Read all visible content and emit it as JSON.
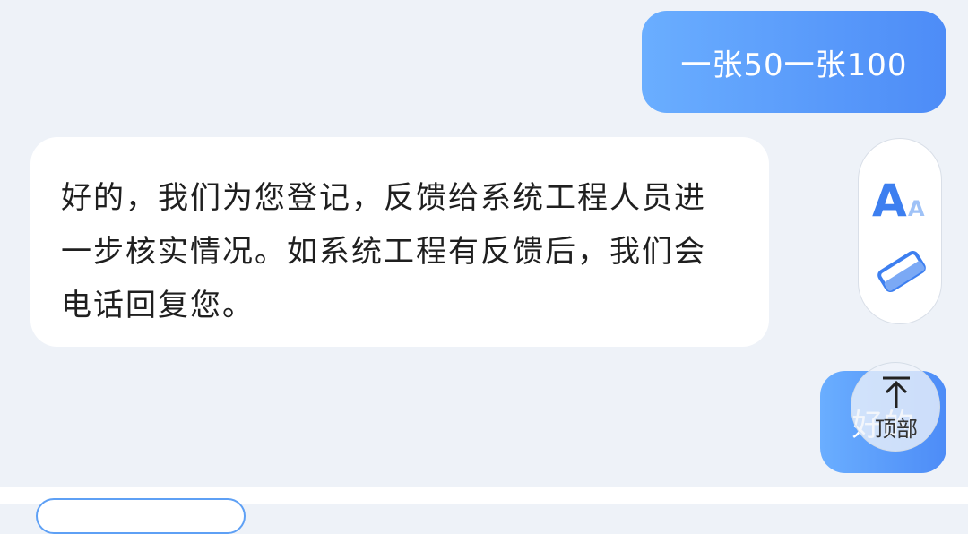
{
  "chat": {
    "messages": [
      {
        "role": "user",
        "text": "一张50一张100"
      },
      {
        "role": "bot",
        "text": "好的，我们为您登记，反馈给系统工程人员进一步核实情况。如系统工程有反馈后，我们会电话回复您。"
      },
      {
        "role": "user",
        "text": "好的"
      }
    ]
  },
  "tools": {
    "font_size_icon": "font-size-icon",
    "eraser_icon": "eraser-icon"
  },
  "scroll_top": {
    "label": "顶部",
    "icon": "arrow-up-to-top-icon"
  },
  "colors": {
    "background": "#eef2f8",
    "user_bubble_start": "#6aaeff",
    "user_bubble_end": "#4d8cf7",
    "bot_bubble": "#ffffff",
    "icon_blue": "#3d7ff0",
    "chip_border": "#5ea0f5"
  }
}
